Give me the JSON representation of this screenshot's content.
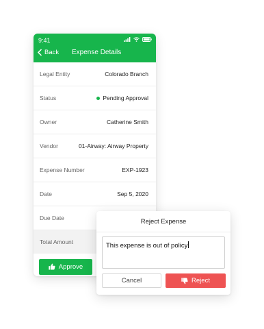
{
  "status_bar": {
    "time": "9:41"
  },
  "nav": {
    "back_label": "Back",
    "title": "Expense Details"
  },
  "details": [
    {
      "label": "Legal Entity",
      "value": "Colorado Branch"
    },
    {
      "label": "Status",
      "value": "Pending Approval",
      "status_color": "#17b54c"
    },
    {
      "label": "Owner",
      "value": "Catherine Smith"
    },
    {
      "label": "Vendor",
      "value": "01-Airway: Airway Property"
    },
    {
      "label": "Expense Number",
      "value": "EXP-1923"
    },
    {
      "label": "Date",
      "value": "Sep 5, 2020"
    },
    {
      "label": "Due Date",
      "value": ""
    },
    {
      "label": "Total Amount",
      "value": ""
    }
  ],
  "actions": {
    "approve_label": "Approve"
  },
  "reject_dialog": {
    "title": "Reject Expense",
    "reason_text": "This expense is out of policy",
    "cancel_label": "Cancel",
    "reject_label": "Reject"
  },
  "colors": {
    "brand_green": "#17b54c",
    "reject_red": "#ee5353"
  },
  "icons": [
    "signal-icon",
    "wifi-icon",
    "battery-icon",
    "chevron-left-icon",
    "thumbs-up-icon",
    "thumbs-down-icon"
  ]
}
